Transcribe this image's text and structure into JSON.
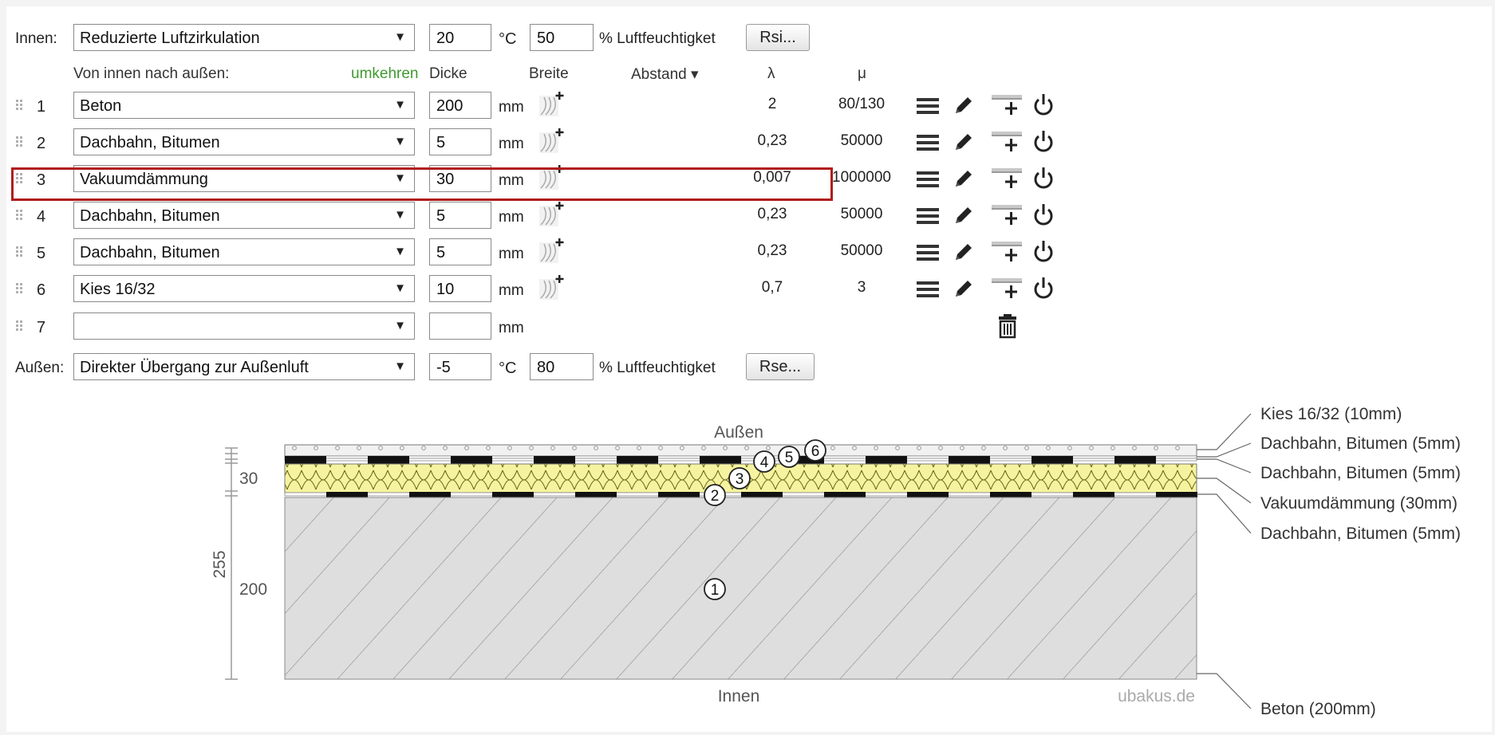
{
  "inside": {
    "label": "Innen:",
    "climate": "Reduzierte Luftzirkulation",
    "temperature": "20",
    "temp_unit": "°C",
    "humidity": "50",
    "humidity_label": "% Luftfeuchtigket",
    "rsi_button": "Rsi..."
  },
  "columns": {
    "direction": "Von innen nach außen:",
    "reverse_link": "umkehren",
    "thickness": "Dicke",
    "width": "Breite",
    "spacing": "Abstand ▾",
    "lambda": "λ",
    "mu": "μ"
  },
  "layers": [
    {
      "index": "1",
      "material": "Beton",
      "thickness": "200",
      "unit": "mm",
      "lambda": "2",
      "mu": "80/130"
    },
    {
      "index": "2",
      "material": "Dachbahn, Bitumen",
      "thickness": "5",
      "unit": "mm",
      "lambda": "0,23",
      "mu": "50000"
    },
    {
      "index": "3",
      "material": "Vakuumdämmung",
      "thickness": "30",
      "unit": "mm",
      "lambda": "0,007",
      "mu": "1000000"
    },
    {
      "index": "4",
      "material": "Dachbahn, Bitumen",
      "thickness": "5",
      "unit": "mm",
      "lambda": "0,23",
      "mu": "50000"
    },
    {
      "index": "5",
      "material": "Dachbahn, Bitumen",
      "thickness": "5",
      "unit": "mm",
      "lambda": "0,23",
      "mu": "50000"
    },
    {
      "index": "6",
      "material": "Kies 16/32",
      "thickness": "10",
      "unit": "mm",
      "lambda": "0,7",
      "mu": "3"
    },
    {
      "index": "7",
      "material": "",
      "thickness": "",
      "unit": "mm",
      "lambda": "",
      "mu": ""
    }
  ],
  "outside": {
    "label": "Außen:",
    "climate": "Direkter Übergang zur Außenluft",
    "temperature": "-5",
    "temp_unit": "°C",
    "humidity": "80",
    "humidity_label": "% Luftfeuchtigket",
    "rse_button": "Rse..."
  },
  "diagram": {
    "top_label": "Außen",
    "bottom_label": "Innen",
    "watermark": "ubakus.de",
    "dim_total": "255",
    "dim_insulation": "30",
    "dim_concrete": "200",
    "markers": [
      "1",
      "2",
      "3",
      "4",
      "5",
      "6"
    ],
    "layer_labels": [
      "Kies 16/32 (10mm)",
      "Dachbahn, Bitumen (5mm)",
      "Dachbahn, Bitumen (5mm)",
      "Vakuumdämmung (30mm)",
      "Dachbahn, Bitumen (5mm)",
      "Beton (200mm)"
    ]
  },
  "icons": {
    "grip": "drag-handle-icon",
    "width_tool": "wood-grain-plus-icon",
    "menu": "menu-icon",
    "edit": "pencil-icon",
    "add_layer": "add-layer-icon",
    "toggle": "power-icon",
    "delete": "trash-icon"
  },
  "colors": {
    "highlight": "#b01c1c",
    "link_green": "#3f9a2f",
    "insulation": "#f6f3a0",
    "concrete": "#dedede",
    "bitumen": "#111111"
  }
}
